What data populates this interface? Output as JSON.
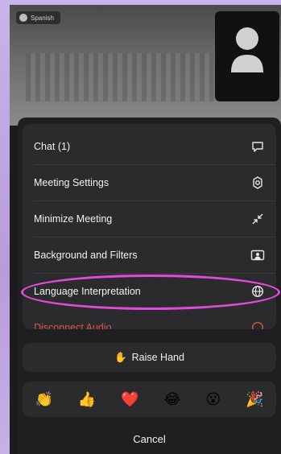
{
  "top": {
    "language_chip": "Spanish"
  },
  "menu": {
    "items": [
      {
        "label": "Chat (1)",
        "icon": "chat-bubble-icon"
      },
      {
        "label": "Meeting Settings",
        "icon": "gear-icon"
      },
      {
        "label": "Minimize Meeting",
        "icon": "minimize-arrows-icon"
      },
      {
        "label": "Background and Filters",
        "icon": "portrait-frame-icon"
      },
      {
        "label": "Language Interpretation",
        "icon": "globe-icon"
      },
      {
        "label": "Disconnect Audio",
        "icon": "disconnect-icon"
      }
    ]
  },
  "actions": {
    "raise_hand_label": "Raise Hand",
    "raise_hand_emoji": "✋",
    "reactions": [
      "👏",
      "👍",
      "❤️",
      "😂",
      "😮",
      "🎉"
    ],
    "cancel_label": "Cancel"
  },
  "colors": {
    "highlight": "#e04bd8",
    "danger": "#d9534f",
    "sheet": "#1f1f21",
    "card": "#2b2b2e"
  }
}
